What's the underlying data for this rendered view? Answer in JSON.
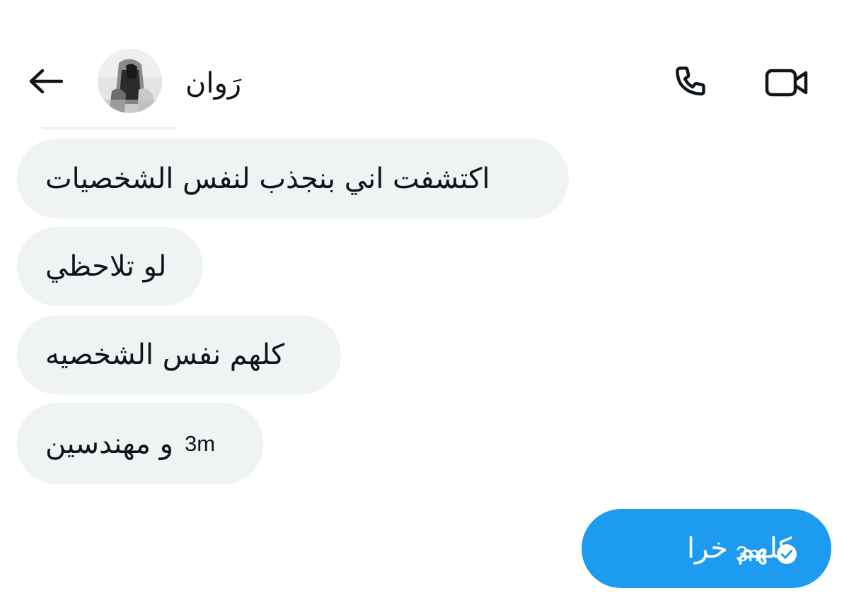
{
  "header": {
    "back_icon": "arrow-left-icon",
    "contact_name": "رَوان",
    "call_icon": "phone-icon",
    "video_icon": "video-camera-icon"
  },
  "messages": [
    {
      "direction": "received",
      "text": "اكتشفت اني بنجذب لنفس الشخصيات"
    },
    {
      "direction": "received",
      "text": "لو تلاحظي"
    },
    {
      "direction": "received",
      "text": "كلهم نفس الشخصيه"
    },
    {
      "direction": "received",
      "text": "و مهندسين",
      "timestamp": "3m"
    },
    {
      "direction": "sent",
      "text": "كلهم خرا",
      "timestamp": "3m",
      "status_icon": "read-check-icon"
    }
  ],
  "colors": {
    "received_bubble": "#eff3f4",
    "sent_bubble": "#1d9bf0",
    "text_primary": "#0f1419",
    "text_on_accent": "#ffffff"
  }
}
